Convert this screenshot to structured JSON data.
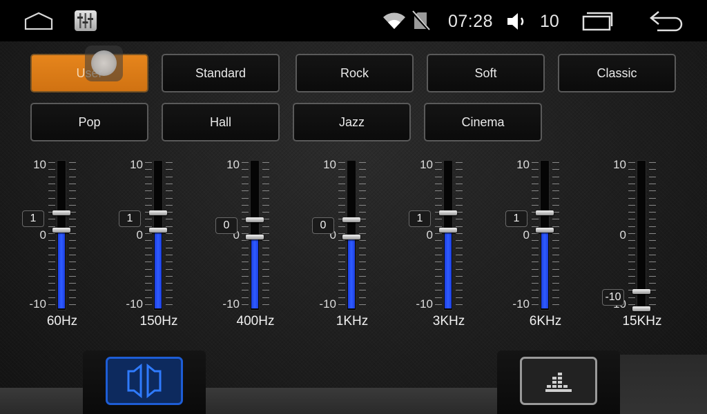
{
  "status_bar": {
    "time": "07:28",
    "volume": "10",
    "icons": [
      "home-icon",
      "equalizer-app-icon",
      "wifi-icon",
      "no-sim-icon",
      "volume-icon",
      "recent-apps-icon",
      "back-icon"
    ]
  },
  "presets": [
    {
      "label": "User",
      "active": true
    },
    {
      "label": "Standard",
      "active": false
    },
    {
      "label": "Rock",
      "active": false
    },
    {
      "label": "Soft",
      "active": false
    },
    {
      "label": "Classic",
      "active": false
    },
    {
      "label": "Pop",
      "active": false
    },
    {
      "label": "Hall",
      "active": false
    },
    {
      "label": "Jazz",
      "active": false
    },
    {
      "label": "Cinema",
      "active": false
    }
  ],
  "equalizer": {
    "scale_max": "10",
    "scale_mid": "0",
    "scale_min": "-10",
    "bands": [
      {
        "freq": "60Hz",
        "value": "1"
      },
      {
        "freq": "150Hz",
        "value": "1"
      },
      {
        "freq": "400Hz",
        "value": "0"
      },
      {
        "freq": "1KHz",
        "value": "0"
      },
      {
        "freq": "3KHz",
        "value": "1"
      },
      {
        "freq": "6KHz",
        "value": "1"
      },
      {
        "freq": "15KHz",
        "value": "-10"
      }
    ]
  },
  "colors": {
    "accent": "#e07d17",
    "slider_fill": "#2a55f5",
    "active_tab": "#1d5dd6"
  },
  "bottom_tabs": [
    {
      "name": "speaker-balance-icon",
      "active": true
    },
    {
      "name": "graphic-eq-icon",
      "active": false
    }
  ]
}
